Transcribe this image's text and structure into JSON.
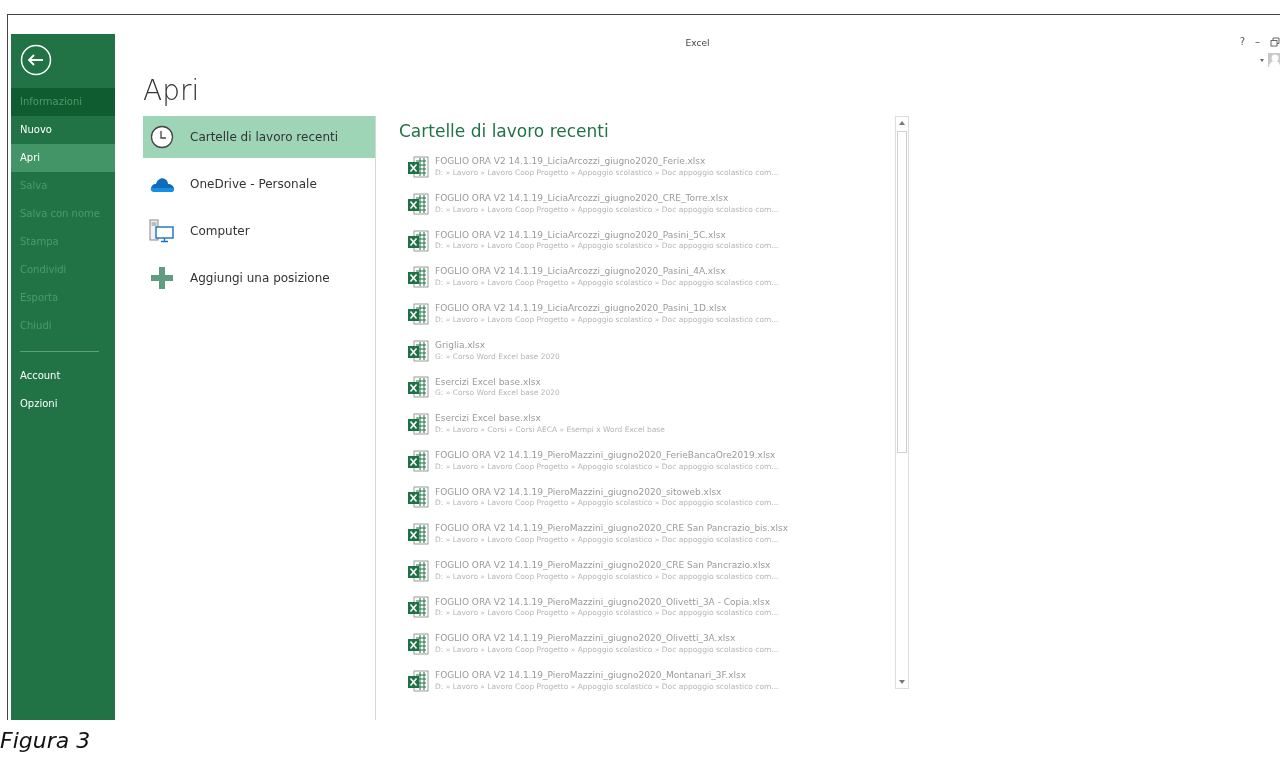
{
  "window": {
    "title": "Excel",
    "help": "?",
    "minimize": "–"
  },
  "sidebar": {
    "items": [
      {
        "label": "Informazioni",
        "selected": false,
        "disabled": true,
        "highlighted": true
      },
      {
        "label": "Nuovo",
        "selected": false,
        "disabled": false,
        "highlighted": false
      },
      {
        "label": "Apri",
        "selected": true,
        "disabled": false,
        "highlighted": false
      },
      {
        "label": "Salva",
        "selected": false,
        "disabled": true,
        "highlighted": false
      },
      {
        "label": "Salva con nome",
        "selected": false,
        "disabled": true,
        "highlighted": false
      },
      {
        "label": "Stampa",
        "selected": false,
        "disabled": true,
        "highlighted": false
      },
      {
        "label": "Condividi",
        "selected": false,
        "disabled": true,
        "highlighted": false
      },
      {
        "label": "Esporta",
        "selected": false,
        "disabled": true,
        "highlighted": false
      },
      {
        "label": "Chiudi",
        "selected": false,
        "disabled": true,
        "highlighted": false
      }
    ],
    "footer_items": [
      {
        "label": "Account",
        "selected": false,
        "disabled": false,
        "highlighted": false
      },
      {
        "label": "Opzioni",
        "selected": false,
        "disabled": false,
        "highlighted": false
      }
    ]
  },
  "page_title": "Apri",
  "places": [
    {
      "label": "Cartelle di lavoro recenti",
      "kind": "recent",
      "selected": true
    },
    {
      "label": "OneDrive - Personale",
      "kind": "cloud",
      "selected": false
    },
    {
      "label": "Computer",
      "kind": "computer",
      "selected": false
    },
    {
      "label": "Aggiungi una posizione",
      "kind": "add",
      "selected": false
    }
  ],
  "recent": {
    "title": "Cartelle di lavoro recenti",
    "files": [
      {
        "name": "FOGLIO ORA V2 14.1.19_LiciaArcozzi_giugno2020_Ferie.xlsx",
        "path": "D: » Lavoro » Lavoro Coop Progetto » Appoggio scolastico » Doc appoggio scolastico com..."
      },
      {
        "name": "FOGLIO ORA V2 14.1.19_LiciaArcozzi_giugno2020_CRE_Torre.xlsx",
        "path": "D: » Lavoro » Lavoro Coop Progetto » Appoggio scolastico » Doc appoggio scolastico com..."
      },
      {
        "name": "FOGLIO ORA V2 14.1.19_LiciaArcozzi_giugno2020_Pasini_5C.xlsx",
        "path": "D: » Lavoro » Lavoro Coop Progetto » Appoggio scolastico » Doc appoggio scolastico com..."
      },
      {
        "name": "FOGLIO ORA V2 14.1.19_LiciaArcozzi_giugno2020_Pasini_4A.xlsx",
        "path": "D: » Lavoro » Lavoro Coop Progetto » Appoggio scolastico » Doc appoggio scolastico com..."
      },
      {
        "name": "FOGLIO ORA V2 14.1.19_LiciaArcozzi_giugno2020_Pasini_1D.xlsx",
        "path": "D: » Lavoro » Lavoro Coop Progetto » Appoggio scolastico » Doc appoggio scolastico com..."
      },
      {
        "name": "Griglia.xlsx",
        "path": "G: » Corso Word Excel base 2020"
      },
      {
        "name": "Esercizi Excel base.xlsx",
        "path": "G: » Corso Word Excel base 2020"
      },
      {
        "name": "Esercizi Excel base.xlsx",
        "path": "D: » Lavoro » Corsi » Corsi AECA » Esempi x Word Excel base"
      },
      {
        "name": "FOGLIO ORA V2 14.1.19_PieroMazzini_giugno2020_FerieBancaOre2019.xlsx",
        "path": "D: » Lavoro » Lavoro Coop Progetto » Appoggio scolastico » Doc appoggio scolastico com..."
      },
      {
        "name": "FOGLIO ORA V2 14.1.19_PieroMazzini_giugno2020_sitoweb.xlsx",
        "path": "D: » Lavoro » Lavoro Coop Progetto » Appoggio scolastico » Doc appoggio scolastico com..."
      },
      {
        "name": "FOGLIO ORA V2 14.1.19_PieroMazzini_giugno2020_CRE San Pancrazio_bis.xlsx",
        "path": "D: » Lavoro » Lavoro Coop Progetto » Appoggio scolastico » Doc appoggio scolastico com..."
      },
      {
        "name": "FOGLIO ORA V2 14.1.19_PieroMazzini_giugno2020_CRE San Pancrazio.xlsx",
        "path": "D: » Lavoro » Lavoro Coop Progetto » Appoggio scolastico » Doc appoggio scolastico com..."
      },
      {
        "name": "FOGLIO ORA V2 14.1.19_PieroMazzini_giugno2020_Olivetti_3A - Copia.xlsx",
        "path": "D: » Lavoro » Lavoro Coop Progetto » Appoggio scolastico » Doc appoggio scolastico com..."
      },
      {
        "name": "FOGLIO ORA V2 14.1.19_PieroMazzini_giugno2020_Olivetti_3A.xlsx",
        "path": "D: » Lavoro » Lavoro Coop Progetto » Appoggio scolastico » Doc appoggio scolastico com..."
      },
      {
        "name": "FOGLIO ORA V2 14.1.19_PieroMazzini_giugno2020_Montanari_3F.xlsx",
        "path": "D: » Lavoro » Lavoro Coop Progetto » Appoggio scolastico » Doc appoggio scolastico com..."
      }
    ]
  },
  "caption": "Figura 3"
}
